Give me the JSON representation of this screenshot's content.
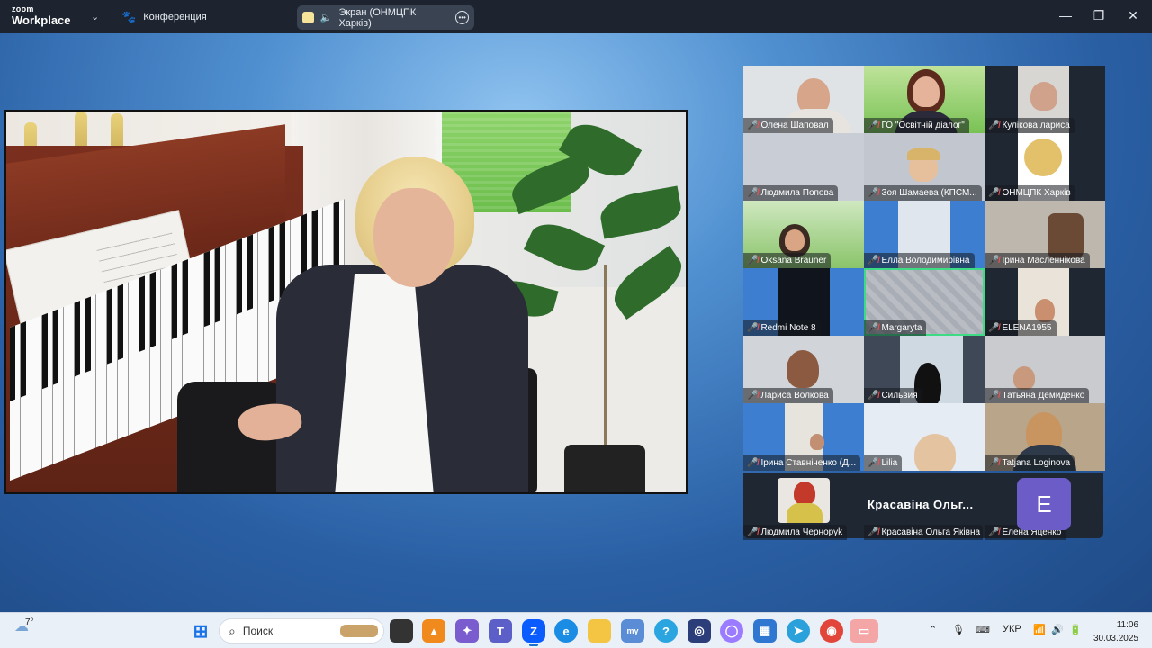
{
  "titlebar": {
    "logo_small": "zoom",
    "logo_big": "Workplace",
    "conference_label": "Конференция",
    "screen_label": "Экран (ОНМЦПК Харків)",
    "minimize": "—",
    "maximize": "❐",
    "close": "✕"
  },
  "gallery": {
    "tiles": [
      {
        "name": "Олена Шаповал"
      },
      {
        "name": "ГО \"Освітній діалог\""
      },
      {
        "name": "Кулікова лариса"
      },
      {
        "name": "Людмила Попова"
      },
      {
        "name": "Зоя Шамаева (КПСМ..."
      },
      {
        "name": "ОНМЦПК Харків"
      },
      {
        "name": "Oksana Brauner"
      },
      {
        "name": "Елла Володимирівна"
      },
      {
        "name": "Ірина Масленнікова"
      },
      {
        "name": "Redmi Note 8"
      },
      {
        "name": "Margaryta"
      },
      {
        "name": "ELENA1955"
      },
      {
        "name": "Лариса Волкова"
      },
      {
        "name": "Сильвия"
      },
      {
        "name": "Татьяна Демиденко"
      },
      {
        "name": "Ірина Ставніченко (Д..."
      },
      {
        "name": "Lilia"
      },
      {
        "name": "Tatjana Loginova"
      },
      {
        "name": "Людмила Черноруk"
      },
      {
        "name": "Красавіна Ольга Яківна"
      },
      {
        "name": "Елена Яценко"
      }
    ],
    "big_name": "Красавіна Ольг...",
    "avatar_letter": "E"
  },
  "taskbar": {
    "weather_temp": "7°",
    "search_placeholder": "Поиск",
    "lang": "УКР",
    "time": "11:06",
    "date": "30.03.2025"
  },
  "colors": {
    "accent_active": "#3ddc84",
    "mic_off": "#ff4d4d"
  }
}
